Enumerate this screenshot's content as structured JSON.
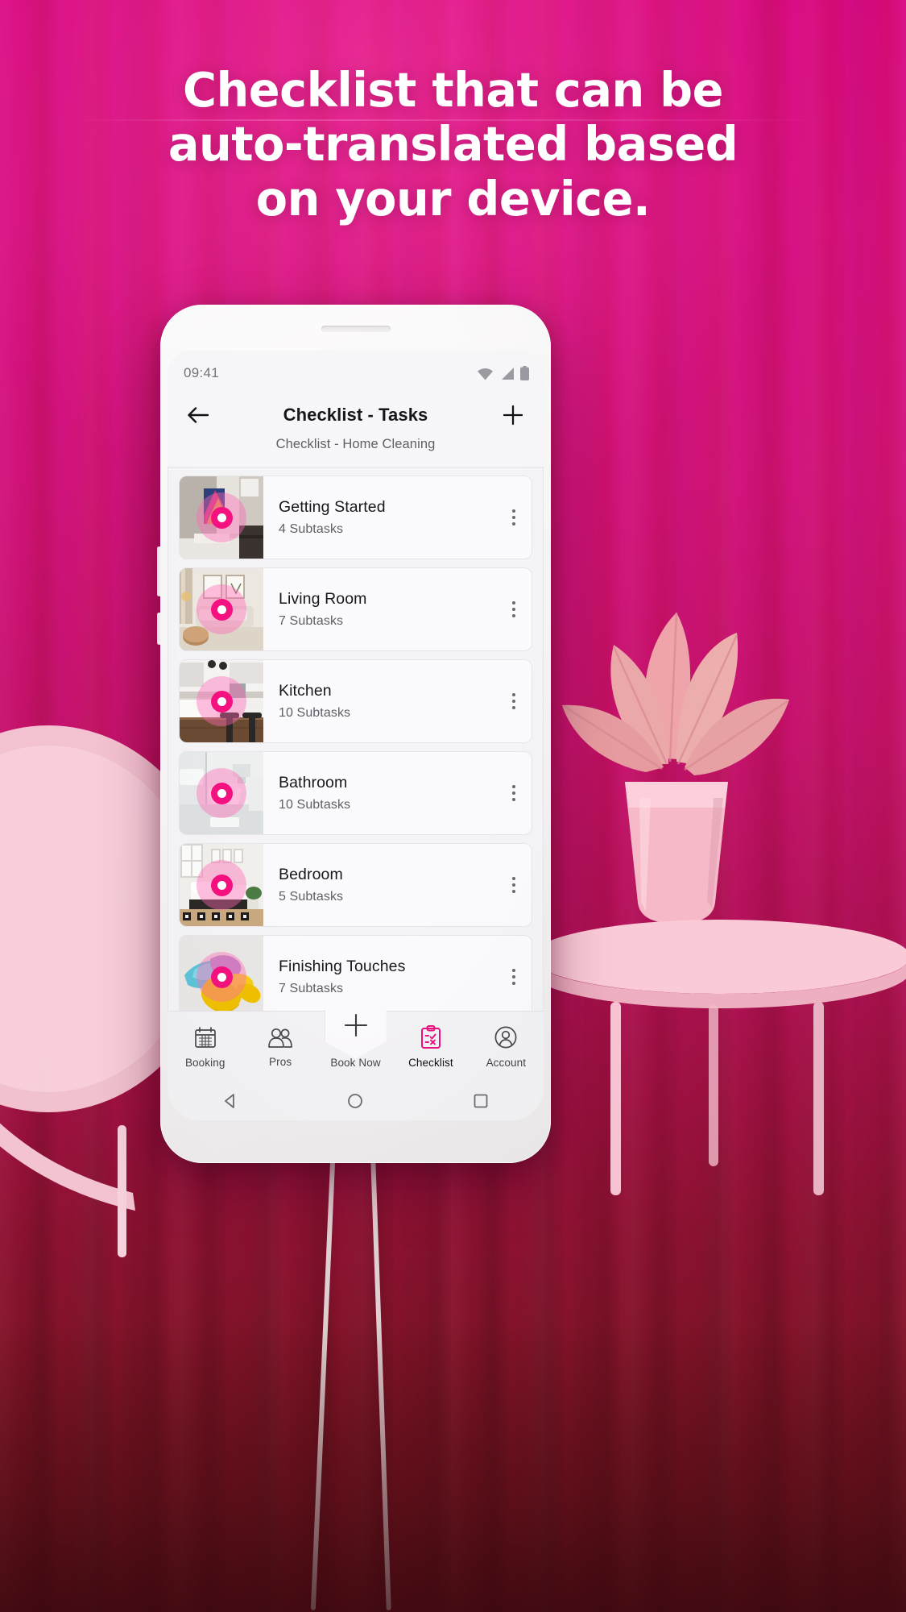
{
  "promo": {
    "headline_lines": [
      "Checklist that can be",
      "auto-translated based",
      "on your device."
    ],
    "bg_color_top": "#d70a7e",
    "bg_color_bottom": "#6e131b",
    "accent_color": "#f5117f"
  },
  "phone": {
    "status_bar": {
      "time": "09:41",
      "icons": [
        "wifi-icon",
        "cellular-signal-icon",
        "battery-icon"
      ]
    },
    "app_bar": {
      "back_label": "Back",
      "title": "Checklist - Tasks",
      "subtitle": "Checklist - Home Cleaning",
      "add_label": "Add"
    },
    "tasks": [
      {
        "title": "Getting Started",
        "subtasks": "4 Subtasks",
        "thumb": "hallway-photo"
      },
      {
        "title": "Living Room",
        "subtasks": "7 Subtasks",
        "thumb": "living-room-photo"
      },
      {
        "title": "Kitchen",
        "subtasks": "10 Subtasks",
        "thumb": "kitchen-photo"
      },
      {
        "title": "Bathroom",
        "subtasks": "10 Subtasks",
        "thumb": "bathroom-photo"
      },
      {
        "title": "Bedroom",
        "subtasks": "5 Subtasks",
        "thumb": "bedroom-photo"
      },
      {
        "title": "Finishing Touches",
        "subtasks": "7 Subtasks",
        "thumb": "cleaning-glove-photo"
      }
    ],
    "bottom_nav": {
      "items": [
        {
          "label": "Booking",
          "icon": "calendar-icon",
          "active": false
        },
        {
          "label": "Pros",
          "icon": "people-icon",
          "active": false
        },
        {
          "label": "Book Now",
          "icon": "plus-icon",
          "active": false
        },
        {
          "label": "Checklist",
          "icon": "clipboard-check-icon",
          "active": true
        },
        {
          "label": "Account",
          "icon": "person-circle-icon",
          "active": false
        }
      ],
      "active_color": "#e8117f"
    },
    "android_nav": [
      "back-triangle-icon",
      "home-circle-icon",
      "recents-square-icon"
    ]
  }
}
